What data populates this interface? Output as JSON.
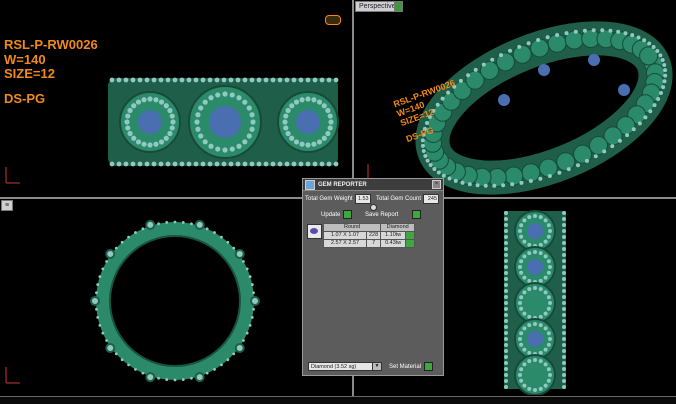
{
  "overlay": {
    "line1": "RSL-P-RW0026",
    "line2": "W=140",
    "line3": "SIZE=12",
    "line4": "DS-PG"
  },
  "viewports": {
    "perspective_label": "Perspective",
    "left_label": "≡"
  },
  "gem_reporter": {
    "title": "GEM REPORTER",
    "total_weight_label": "Total Gem Weight",
    "total_weight_value": "1.53",
    "total_count_label": "Total Gem Count",
    "total_count_value": "245",
    "update_label": "Update",
    "save_report_label": "Save Report",
    "table_headers": [
      "Round",
      "Diamond"
    ],
    "rows": [
      {
        "size": "1.07 X 1.07",
        "count": "228",
        "weight": "1.10tw"
      },
      {
        "size": "2.57 X 2.57",
        "count": "7",
        "weight": "0.43tw"
      }
    ],
    "material_select": "Diamond   (3.52 sg)",
    "set_material_label": "Set Material"
  },
  "colors": {
    "metal": "#2a8a6a",
    "gem": "#8fc9c0",
    "center_stone": "#4a6fb0",
    "overlay_text": "#f08a1a",
    "accent_button": "#3ea83e"
  }
}
